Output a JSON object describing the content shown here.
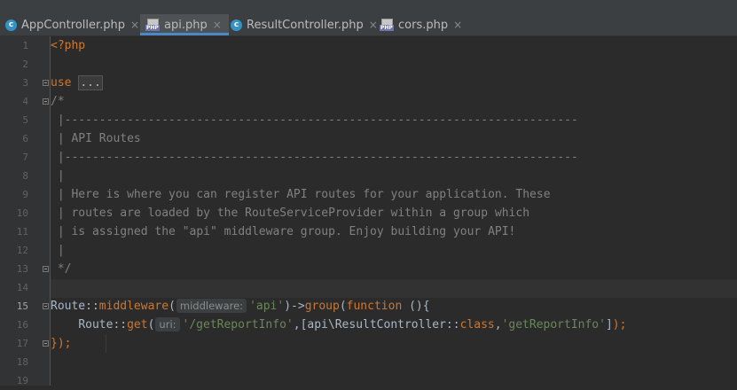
{
  "tabs": [
    {
      "label": "AppController.php",
      "icon": "class-c-icon",
      "active": false
    },
    {
      "label": "api.php",
      "icon": "php-file-icon",
      "active": true
    },
    {
      "label": "ResultController.php",
      "icon": "class-c-icon",
      "active": false
    },
    {
      "label": "cors.php",
      "icon": "php-file-icon",
      "active": false
    }
  ],
  "close_glyph": "×",
  "class_icon_letter": "c",
  "php_icon_label": "PHP",
  "line_numbers": [
    "1",
    "2",
    "3",
    "4",
    "5",
    "6",
    "7",
    "8",
    "9",
    "10",
    "11",
    "12",
    "13",
    "14",
    "15",
    "16",
    "17",
    "18",
    "19"
  ],
  "current_line": "15",
  "code": {
    "l1_open_tag": "<?php",
    "l3_use": "use",
    "l3_folded": "...",
    "l5": "/*",
    "l6": " |--------------------------------------------------------------------------",
    "l7": " | API Routes",
    "l8": " |--------------------------------------------------------------------------",
    "l9": " |",
    "l10": " | Here is where you can register API routes for your application. These",
    "l11": " | routes are loaded by the RouteServiceProvider within a group which",
    "l12": " | is assigned the \"api\" middleware group. Enjoy building your API!",
    "l13": " |",
    "l14": " */",
    "l16_route": "Route",
    "l16_sep": "::",
    "l16_method": "middleware",
    "l16_paren": "(",
    "l16_hint": "middleware:",
    "l16_arg": "'api'",
    "l16_arrow": ")->",
    "l16_group": "group",
    "l16_paren2": "(",
    "l16_function": "function",
    "l16_tail": " (){",
    "l17_indent": "    ",
    "l17_route": "Route",
    "l17_sep": "::",
    "l17_get": "get",
    "l17_paren": "(",
    "l17_hint": "uri:",
    "l17_uri": "'/getReportInfo'",
    "l17_mid": ",[api\\ResultController::",
    "l17_class": "class",
    "l17_comma": ",",
    "l17_action": "'getReportInfo'",
    "l17_end": "]",
    "l17_semi_close": ");",
    "l18_close": "});",
    "l18_semi": ""
  },
  "colors": {
    "background": "#2b2b2b",
    "keyword": "#cc7832",
    "comment": "#808080",
    "string": "#6a8759",
    "text": "#a9b7c6",
    "active_tab_underline": "#4a88c7"
  }
}
